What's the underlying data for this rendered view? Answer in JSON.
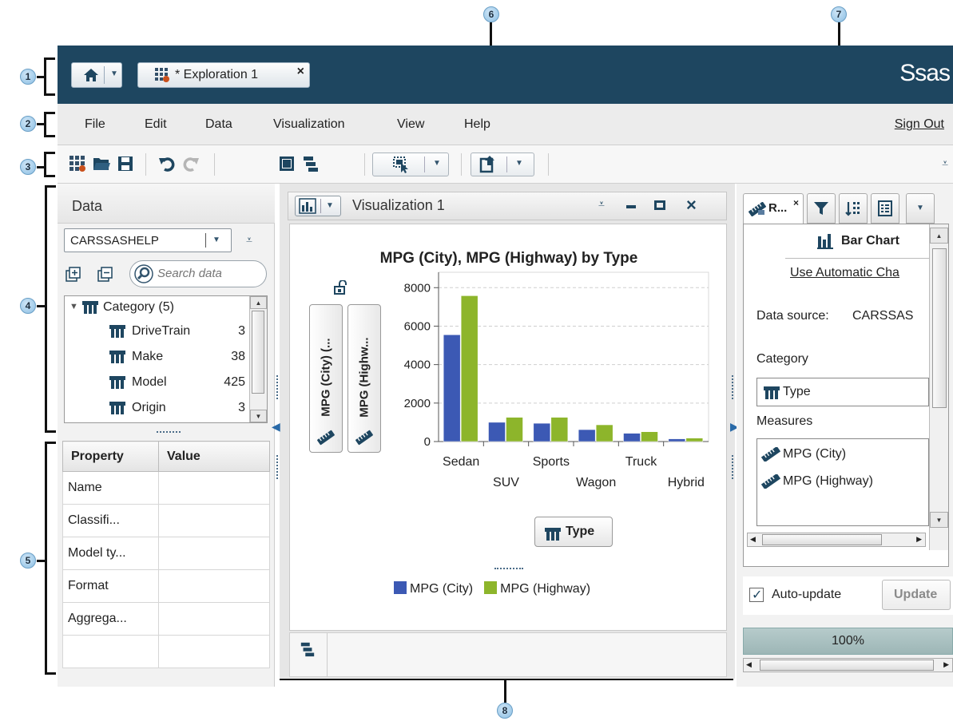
{
  "callouts": [
    "1",
    "2",
    "3",
    "4",
    "5",
    "6",
    "7",
    "8"
  ],
  "header": {
    "home_icon": "home-icon",
    "tab_label": "* Exploration 1",
    "logo_text": "Ssas",
    "close_glyph": "×"
  },
  "menu": {
    "items": [
      "File",
      "Edit",
      "Data",
      "Visualization",
      "View",
      "Help"
    ],
    "sign_out": "Sign Out"
  },
  "toolbar": {
    "icons": [
      "new-exploration-icon",
      "open-icon",
      "save-icon",
      "undo-icon",
      "redo-icon",
      "single-layout-icon",
      "stacked-layout-icon",
      "select-icon",
      "export-icon"
    ]
  },
  "data_pane": {
    "title": "Data",
    "data_source": "CARSSASHELP",
    "search_placeholder": "Search data",
    "tree": [
      {
        "label": "Category (5)",
        "count": ""
      },
      {
        "label": "DriveTrain",
        "count": "3"
      },
      {
        "label": "Make",
        "count": "38"
      },
      {
        "label": "Model",
        "count": "425"
      },
      {
        "label": "Origin",
        "count": "3"
      }
    ]
  },
  "properties": {
    "headers": [
      "Property",
      "Value"
    ],
    "rows": [
      "Name",
      "Classifi...",
      "Model ty...",
      "Format",
      "Aggrega...",
      ""
    ]
  },
  "viz": {
    "title": "Visualization 1",
    "role_y1": "MPG (City) (...",
    "role_y2": "MPG (Highw...",
    "x_role": "Type"
  },
  "chart_data": {
    "type": "bar",
    "title": "MPG (City), MPG (Highway) by Type",
    "categories": [
      "Sedan",
      "SUV",
      "Sports",
      "Wagon",
      "Truck",
      "Hybrid"
    ],
    "series": [
      {
        "name": "MPG (City)",
        "values": [
          5550,
          1000,
          950,
          620,
          430,
          140
        ],
        "color": "#3c59b4"
      },
      {
        "name": "MPG (Highway)",
        "values": [
          7580,
          1260,
          1260,
          870,
          510,
          180
        ],
        "color": "#8db52b"
      }
    ],
    "yticks": [
      0,
      2000,
      4000,
      6000,
      8000
    ],
    "ylim": [
      0,
      8800
    ],
    "grid": true,
    "legend": "bottom"
  },
  "right_pane": {
    "tab_label": "R...",
    "chart_type": "Bar Chart",
    "auto_chart_link": "Use Automatic Cha",
    "data_source_label": "Data source:",
    "data_source_value": "CARSSAS",
    "category_label": "Category",
    "category_value": "Type",
    "measures_label": "Measures",
    "measures": [
      "MPG (City)",
      "MPG (Highway)"
    ],
    "auto_update_label": "Auto-update",
    "update_button": "Update",
    "zoom": "100%"
  }
}
